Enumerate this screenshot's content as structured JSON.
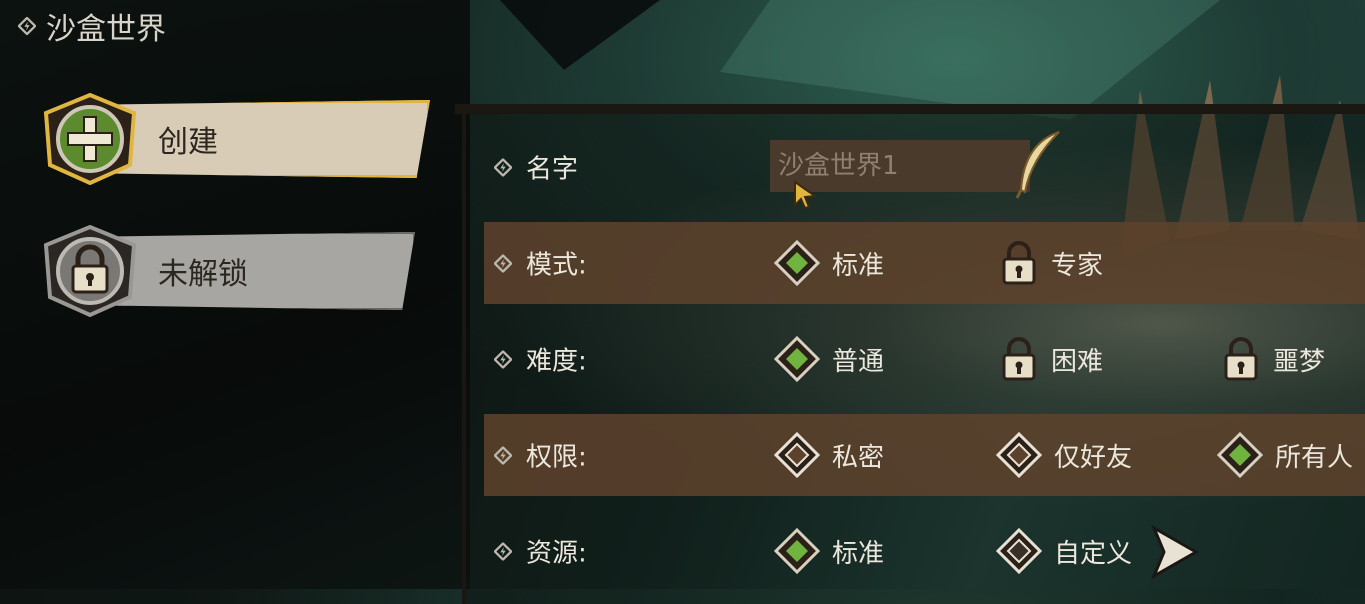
{
  "header": {
    "title": "沙盒世界",
    "icon": "bolt-icon"
  },
  "sidebar": {
    "items": [
      {
        "label": "创建",
        "icon": "plus-badge-icon",
        "state": "active"
      },
      {
        "label": "未解锁",
        "icon": "lock-badge-icon",
        "state": "locked"
      }
    ]
  },
  "form": {
    "name": {
      "label": "名字",
      "placeholder": "沙盒世界1",
      "icon": "quill-icon"
    },
    "mode": {
      "label": "模式:",
      "options": [
        {
          "label": "标准",
          "state": "selected"
        },
        {
          "label": "专家",
          "state": "locked"
        }
      ]
    },
    "difficulty": {
      "label": "难度:",
      "options": [
        {
          "label": "普通",
          "state": "selected"
        },
        {
          "label": "困难",
          "state": "locked"
        },
        {
          "label": "噩梦",
          "state": "locked"
        }
      ]
    },
    "permission": {
      "label": "权限:",
      "options": [
        {
          "label": "私密",
          "state": "unselected"
        },
        {
          "label": "仅好友",
          "state": "unselected"
        },
        {
          "label": "所有人",
          "state": "selected"
        }
      ]
    },
    "resources": {
      "label": "资源:",
      "options": [
        {
          "label": "标准",
          "state": "selected"
        },
        {
          "label": "自定义",
          "state": "unselected"
        }
      ],
      "next_icon": "arrow-right-icon"
    }
  },
  "colors": {
    "accent_green": "#6fb43f",
    "band_brown": "#5c422c",
    "gold_border": "#e0b640",
    "text": "#ece7dc"
  }
}
